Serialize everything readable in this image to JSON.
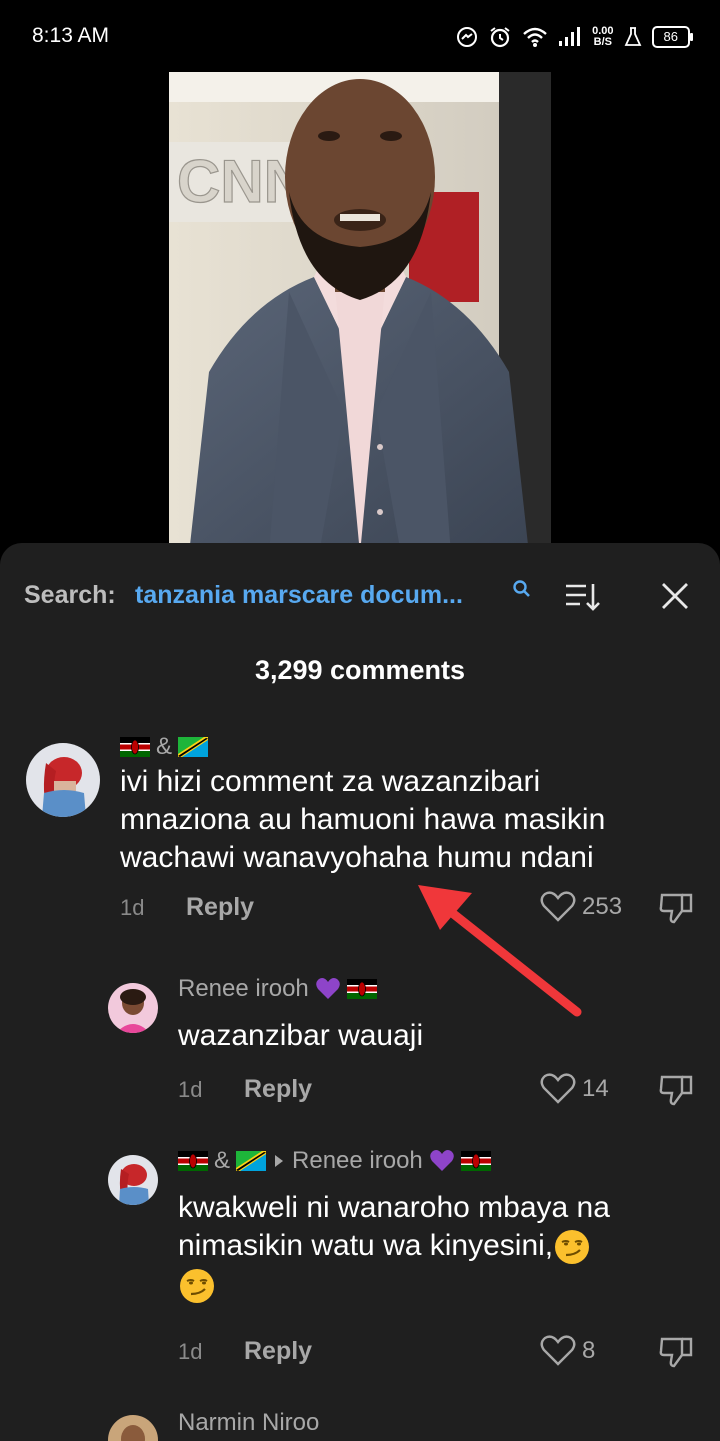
{
  "status_bar": {
    "time": "8:13 AM",
    "speed_value": "0.00",
    "speed_unit": "B/S",
    "battery": "86"
  },
  "search": {
    "label": "Search:",
    "query": "tanzania marscare docum..."
  },
  "comments_count": "3,299 comments",
  "comments": [
    {
      "author_suffix": "&",
      "text_lines": [
        "ivi hizi comment za wazanzibari",
        "mnaziona au hamuoni hawa masikin",
        "wachawi wanavyohaha humu ndani"
      ],
      "age": "1d",
      "reply_label": "Reply",
      "likes": "253"
    },
    {
      "author": "Renee irooh",
      "text_lines": [
        "wazanzibar wauaji"
      ],
      "age": "1d",
      "reply_label": "Reply",
      "likes": "14"
    },
    {
      "author_suffix": "&",
      "reply_to": "Renee irooh",
      "text_lines": [
        "kwakweli ni wanaroho mbaya na",
        "nimasikin watu wa kinyesini,"
      ],
      "age": "1d",
      "reply_label": "Reply",
      "likes": "8"
    },
    {
      "author": "Narmin Niroo"
    }
  ],
  "colors": {
    "sheet_bg": "#1f1f1f",
    "query_blue": "#58a9f0",
    "muted_text": "#a8a8a8",
    "arrow_red": "#f0373a"
  }
}
